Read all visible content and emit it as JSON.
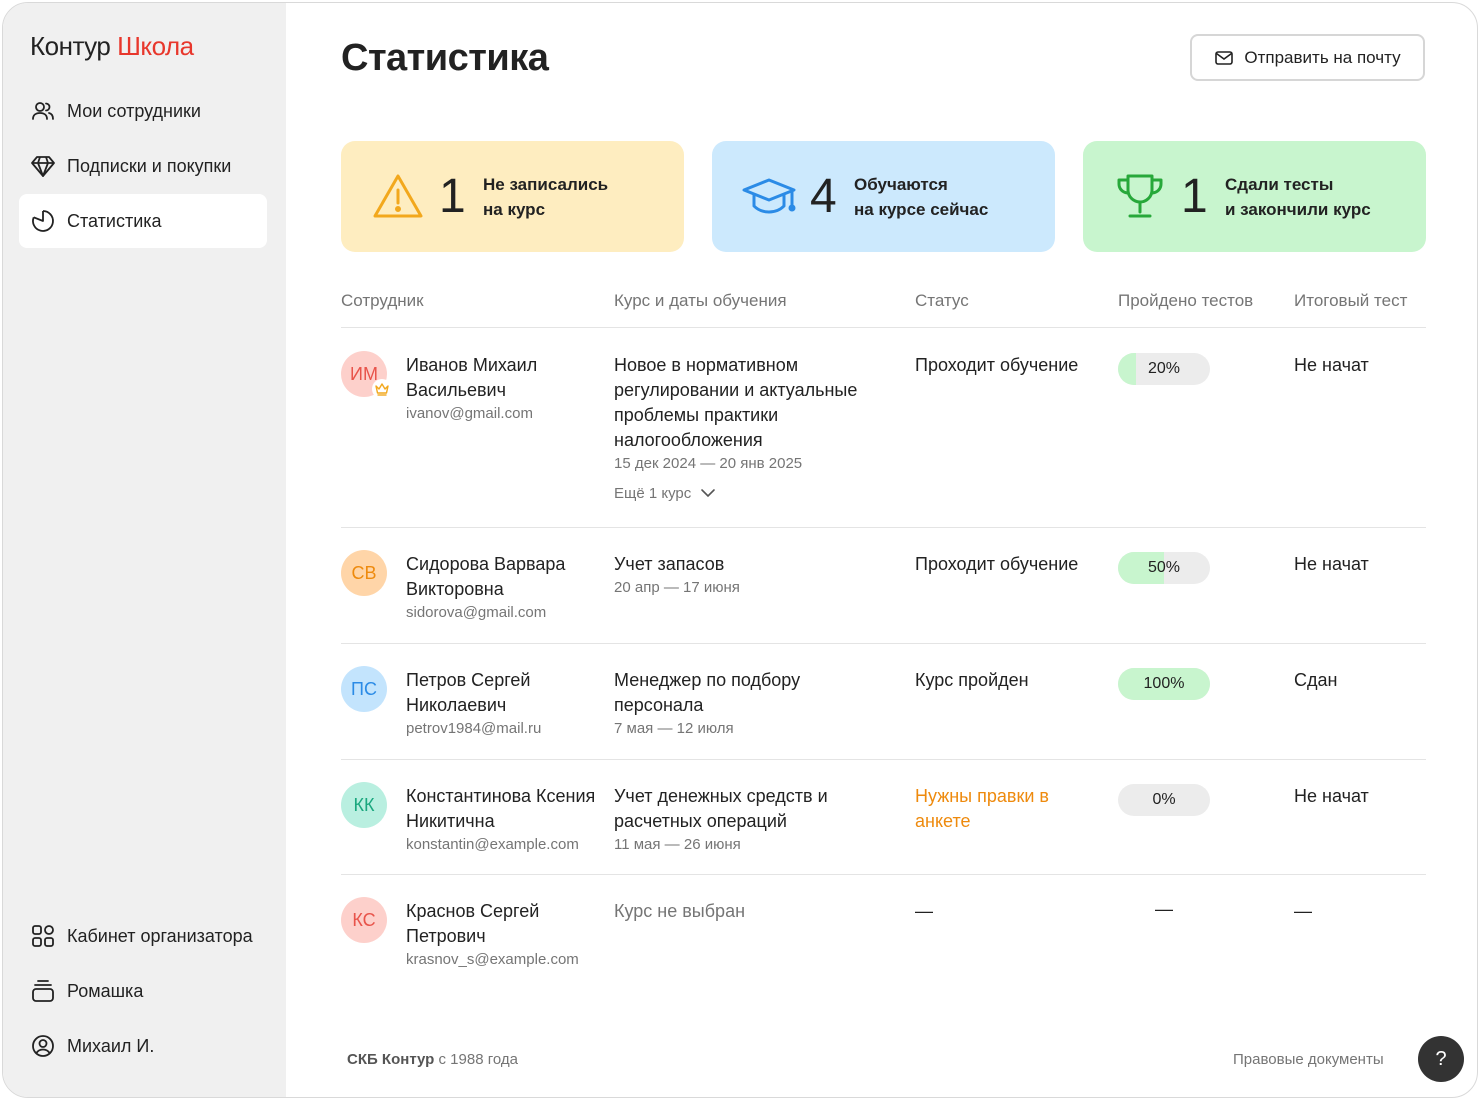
{
  "logo": {
    "part1": "Контур",
    "part2": "Школа"
  },
  "nav": {
    "top": [
      {
        "label": "Мои сотрудники",
        "icon": "users-icon"
      },
      {
        "label": "Подписки и покупки",
        "icon": "diamond-icon"
      },
      {
        "label": "Статистика",
        "icon": "pie-chart-icon",
        "active": true
      }
    ],
    "bottom": [
      {
        "label": "Кабинет организатора",
        "icon": "grid-icon"
      },
      {
        "label": "Ромашка",
        "icon": "stack-icon"
      },
      {
        "label": "Михаил И.",
        "icon": "user-circle-icon"
      }
    ]
  },
  "header": {
    "title": "Статистика",
    "send_label": "Отправить на почту"
  },
  "cards": [
    {
      "count": "1",
      "label": "Не записались\nна курс",
      "icon": "warning-icon",
      "color": "#feedc0"
    },
    {
      "count": "4",
      "label": "Обучаются\nна курсе сейчас",
      "icon": "graduation-cap-icon",
      "color": "#cce9fd"
    },
    {
      "count": "1",
      "label": "Сдали тесты\nи закончили курс",
      "icon": "trophy-icon",
      "color": "#c8f5ce"
    }
  ],
  "table": {
    "headers": [
      "Сотрудник",
      "Курс и даты обучения",
      "Статус",
      "Пройдено тестов",
      "Итоговый тест"
    ],
    "rows": [
      {
        "initials": "ИМ",
        "avatar_bg": "#fdd0cb",
        "avatar_fg": "#e8534a",
        "name": "Иванов Михаил Васильевич",
        "email": "ivanov@gmail.com",
        "course": "Новое в нормативном регулировании и актуальные проблемы практики налогообложения",
        "dates": "15 дек 2024 — 20 янв 2025",
        "more": "Ещё 1 курс",
        "status": "Проходит обучение",
        "progress_label": "20%",
        "progress": 20,
        "final": "Не начат"
      },
      {
        "initials": "СВ",
        "avatar_bg": "#ffd5a8",
        "avatar_fg": "#ee8a0d",
        "name": "Сидорова Варвара Викторовна",
        "email": "sidorova@gmail.com",
        "course": "Учет запасов",
        "dates": "20 апр — 17 июня",
        "status": "Проходит обучение",
        "progress_label": "50%",
        "progress": 50,
        "final": "Не начат"
      },
      {
        "initials": "ПС",
        "avatar_bg": "#c3e4fd",
        "avatar_fg": "#2b8be6",
        "name": "Петров Сергей Николаевич",
        "email": "petrov1984@mail.ru",
        "course": "Менеджер по подбору персонала",
        "dates": "7 мая — 12 июля",
        "status": "Курс пройден",
        "progress_label": "100%",
        "progress": 100,
        "final": "Сдан"
      },
      {
        "initials": "КК",
        "avatar_bg": "#b9efe0",
        "avatar_fg": "#1aa77e",
        "name": "Константинова Ксения Никитична",
        "email": "konstantin@example.com",
        "course": "Учет денежных средств и расчетных операций",
        "dates": "11 мая — 26 июня",
        "status": "Нужны правки в анкете",
        "status_color": "#ee8a0d",
        "progress_label": "0%",
        "progress": 0,
        "final": "Не начат"
      },
      {
        "initials": "КС",
        "avatar_bg": "#fdd0cb",
        "avatar_fg": "#e8534a",
        "name": "Краснов Сергей Петрович",
        "email": "krasnov_s@example.com",
        "course_none": "Курс не выбран",
        "status": "—",
        "tests_dash": "—",
        "final": "—"
      }
    ]
  },
  "footer": {
    "brand": "СКБ Контур",
    "since": " с 1988 года",
    "legal": "Правовые документы",
    "help": "?"
  }
}
